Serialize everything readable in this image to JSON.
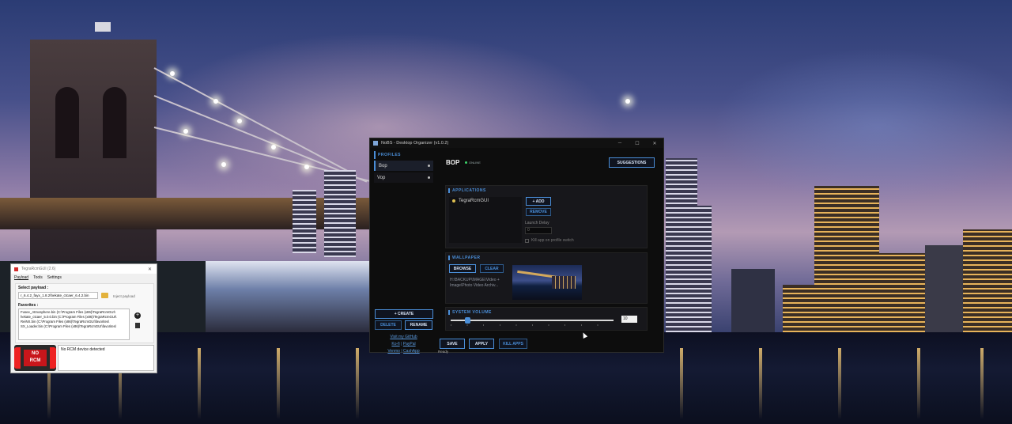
{
  "nobs": {
    "title": "NoBS - Desktop Organizer (v1.0.2)",
    "window_controls": [
      "─",
      "☐",
      "✕"
    ],
    "profiles_label": "PROFILES",
    "profiles": [
      {
        "label": "Bop",
        "active": true
      },
      {
        "label": "Vop",
        "active": false
      }
    ],
    "create_label": "+ CREATE",
    "delete_label": "DELETE",
    "rename_label": "RENAME",
    "links": {
      "github": "Visit my GitHub",
      "kofi": "Ko-fi",
      "paypal": "PayPal",
      "venmo": "Venmo",
      "cashapp": "CashApp",
      "separator": "|"
    },
    "profile_title": "BOP",
    "online_status": "ONLINE",
    "suggestions_label": "SUGGESTIONS",
    "applications": {
      "label": "APPLICATIONS",
      "items": [
        "TegraRcmGUI"
      ],
      "add_label": "+ ADD",
      "remove_label": "REMOVE",
      "launch_delay_label": "Launch Delay",
      "launch_delay_value": "0",
      "kill_on_switch_label": "Kill app on profile switch"
    },
    "wallpaper": {
      "label": "WALLPAPER",
      "browse_label": "BROWSE",
      "clear_label": "CLEAR",
      "path": "H:\\BACKUP\\IMAGE\\Video + Image\\Photo  Video Archiv..."
    },
    "volume": {
      "label": "SYSTEM VOLUME",
      "value": "10",
      "level_percent": 10
    },
    "save_label": "SAVE",
    "apply_label": "APPLY",
    "kill_apps_label": "KILL APPS",
    "status": "Ready"
  },
  "tegra": {
    "title": "TegraRcmGUI (2.6)",
    "menu": [
      "Payload",
      "Tools",
      "Settings"
    ],
    "select_payload_label": "Select payload :",
    "payload_path": "r_6.4.2_fayx_1.8.2\\hekate_ctcaer_6.4.2.bin",
    "inject_label": "Inject payload",
    "favorites_label": "Favorites :",
    "favorites": [
      "Fusee_Atmosphere.bin (C:\\Program Files (x86)\\TegraRcmGUI\\",
      "hekate_ctcaer_5.0.0.bin (C:\\Program Files (x86)\\TegraRcmGUI\\",
      "ReiNX.bin (C:\\Program Files (x86)\\TegraRcmGUI\\favorites\\",
      "SX_Loader.bin (C:\\Program Files (x86)\\TegraRcmGUI\\favorites\\"
    ],
    "logo_text_line1": "NO",
    "logo_text_line2": "RCM",
    "device_status": "No RCM device detected"
  }
}
